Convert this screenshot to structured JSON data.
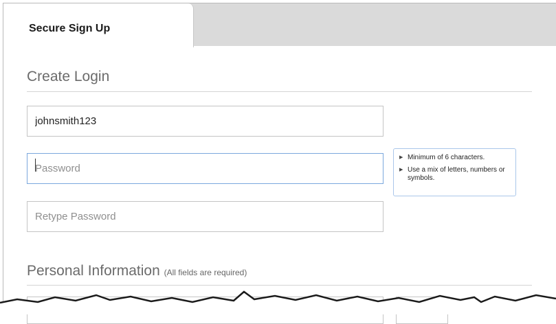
{
  "tabs": [
    {
      "label": "Secure Sign Up",
      "active": true
    }
  ],
  "create_login": {
    "title": "Create Login",
    "username": {
      "value": "johnsmith123"
    },
    "password": {
      "placeholder": "Password",
      "value": ""
    },
    "retype_password": {
      "placeholder": "Retype Password",
      "value": ""
    }
  },
  "password_hint": {
    "items": [
      "Minimum of 6 characters.",
      "Use a mix of letters, numbers or symbols."
    ]
  },
  "personal_information": {
    "title": "Personal Information",
    "note": "(All fields are required)"
  },
  "colors": {
    "tab_bar": "#dadada",
    "focus_border": "#7aa7dd",
    "hint_border": "#a9c6ea"
  },
  "icons": [
    "triangle-right-icon"
  ]
}
